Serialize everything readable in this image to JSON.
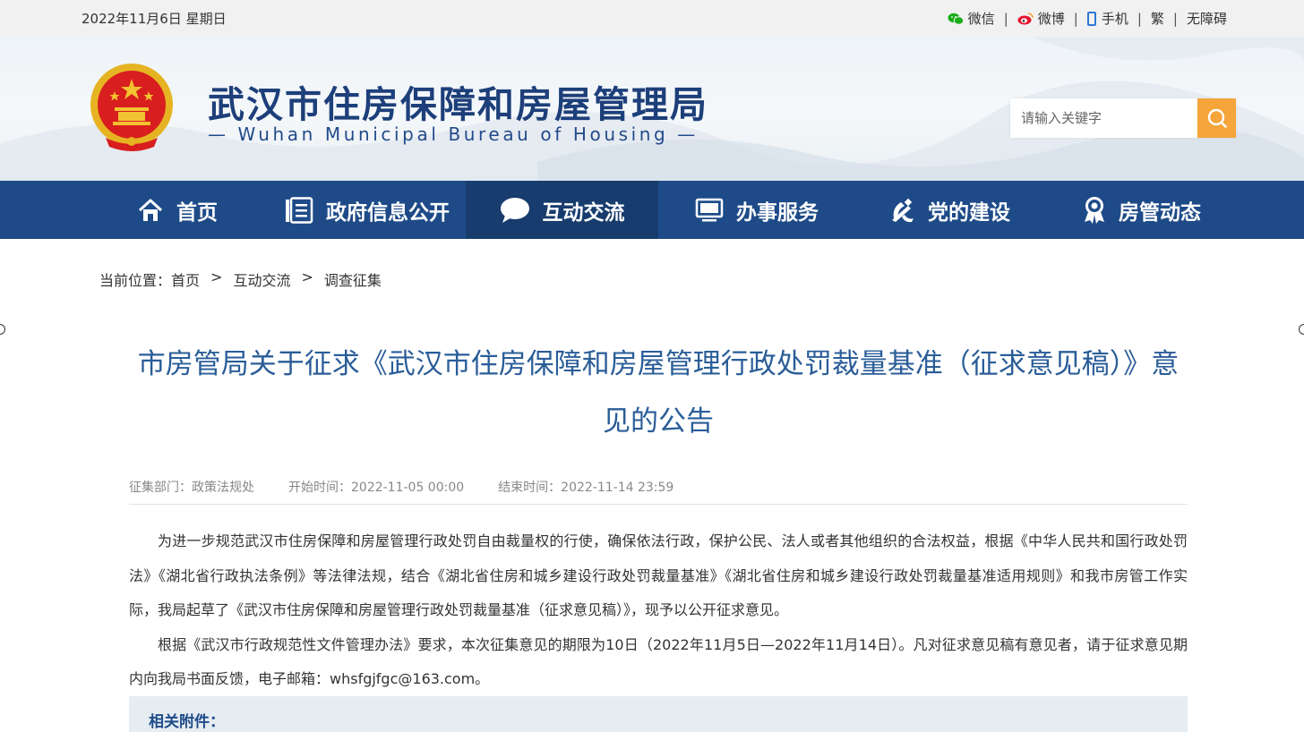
{
  "topbar": {
    "date": "2022年11月6日 星期日",
    "wechat": "微信",
    "weibo": "微博",
    "mobile": "手机",
    "traditional": "繁",
    "accessible": "无障碍",
    "separator": "|"
  },
  "header": {
    "title": "武汉市住房保障和房屋管理局",
    "subtitle": "— Wuhan Municipal Bureau of Housing —",
    "search_placeholder": "请输入关键字"
  },
  "nav": {
    "items": [
      {
        "label": "首页",
        "icon": "home-icon"
      },
      {
        "label": "政府信息公开",
        "icon": "document-list-icon"
      },
      {
        "label": "互动交流",
        "icon": "chat-bubble-icon",
        "active": true
      },
      {
        "label": "办事服务",
        "icon": "monitor-icon"
      },
      {
        "label": "党的建设",
        "icon": "party-emblem-icon"
      },
      {
        "label": "房管动态",
        "icon": "award-icon"
      }
    ]
  },
  "breadcrumb": {
    "prefix": "当前位置：",
    "items": [
      "首页",
      "互动交流",
      "调查征集"
    ],
    "arrow": ">"
  },
  "article": {
    "title": "市房管局关于征求《武汉市住房保障和房屋管理行政处罚裁量基准（征求意见稿）》意见的公告",
    "department": "征集部门：政策法规处",
    "start_time": "开始时间：2022-11-05 00:00",
    "end_time": "结束时间：2022-11-14 23:59",
    "paragraphs": [
      "为进一步规范武汉市住房保障和房屋管理行政处罚自由裁量权的行使，确保依法行政，保护公民、法人或者其他组织的合法权益，根据《中华人民共和国行政处罚法》《湖北省行政执法条例》等法律法规，结合《湖北省住房和城乡建设行政处罚裁量基准》《湖北省住房和城乡建设行政处罚裁量基准适用规则》和我市房管工作实际，我局起草了《武汉市住房保障和房屋管理行政处罚裁量基准（征求意见稿）》，现予以公开征求意见。",
      "根据《武汉市行政规范性文件管理办法》要求，本次征集意见的期限为10日（2022年11月5日—2022年11月14日）。凡对征求意见稿有意见者，请于征求意见期内向我局书面反馈，电子邮箱：whsfgjfgc@163.com。"
    ],
    "attachments_label": "相关附件："
  },
  "colors": {
    "nav_bg": "#1e4b88",
    "nav_active": "#173c6d",
    "title_blue": "#2a5d98",
    "search_btn": "#f5a53a"
  }
}
